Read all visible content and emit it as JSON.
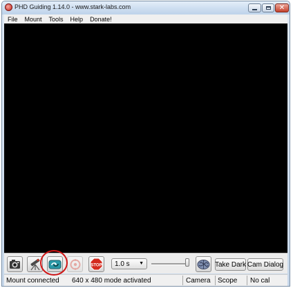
{
  "window": {
    "title": "PHD Guiding 1.14.0  -  www.stark-labs.com",
    "controls": [
      "minimize-icon",
      "maximize-icon",
      "close-icon"
    ]
  },
  "menu": [
    "File",
    "Mount",
    "Tools",
    "Help",
    "Donate!"
  ],
  "toolbar": {
    "exposure": "1.0 s",
    "take_dark": "Take Dark",
    "cam_dialog": "Cam Dialog",
    "stop_label": "STOP",
    "icons": [
      "camera-icon",
      "telescope-icon",
      "loop-icon",
      "guide-icon",
      "stop-icon",
      "brain-icon"
    ]
  },
  "status": {
    "message": "Mount connected",
    "mode": "640 x 480 mode activated",
    "camera": "Camera",
    "scope": "Scope",
    "cal": "No cal"
  },
  "colors": {
    "canvas": "#000000",
    "highlight": "#d01616"
  }
}
